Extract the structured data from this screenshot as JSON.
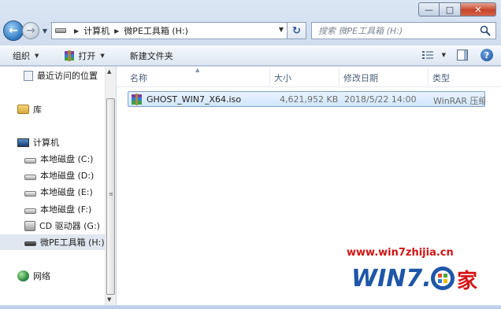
{
  "address": {
    "crumbs": [
      "计算机",
      "微PE工具箱 (H:)"
    ]
  },
  "search": {
    "placeholder": "搜索 微PE工具箱 (H:)"
  },
  "toolbar": {
    "organize": "组织",
    "open": "打开",
    "new_folder": "新建文件夹"
  },
  "nav": {
    "items": [
      {
        "label": "最近访问的位置",
        "icon": "recent-places-icon"
      },
      {
        "label": "库",
        "icon": "library-icon"
      },
      {
        "label": "计算机",
        "icon": "computer-icon"
      },
      {
        "label": "本地磁盘 (C:)",
        "icon": "system-drive-icon"
      },
      {
        "label": "本地磁盘 (D:)",
        "icon": "drive-icon"
      },
      {
        "label": "本地磁盘 (E:)",
        "icon": "drive-icon"
      },
      {
        "label": "本地磁盘 (F:)",
        "icon": "drive-icon"
      },
      {
        "label": "CD 驱动器 (G:)",
        "icon": "cd-drive-icon"
      },
      {
        "label": "微PE工具箱 (H:)",
        "icon": "usb-drive-icon",
        "selected": true
      },
      {
        "label": "网络",
        "icon": "network-icon"
      }
    ]
  },
  "columns": {
    "name": "名称",
    "size": "大小",
    "modified": "修改日期",
    "type": "类型"
  },
  "files": [
    {
      "name": "GHOST_WIN7_X64.iso",
      "size": "4,621,952 KB",
      "modified": "2018/5/22 14:00",
      "type": "WinRAR 压缩文件",
      "icon": "winrar-archive-icon"
    }
  ],
  "watermark": {
    "url": "www.win7zhijia.cn",
    "logo_text": "WIN7.之家"
  },
  "colors": {
    "selection": "#d1e6fd",
    "watermark_red": "#d21414",
    "watermark_blue": "#1e56a8"
  }
}
